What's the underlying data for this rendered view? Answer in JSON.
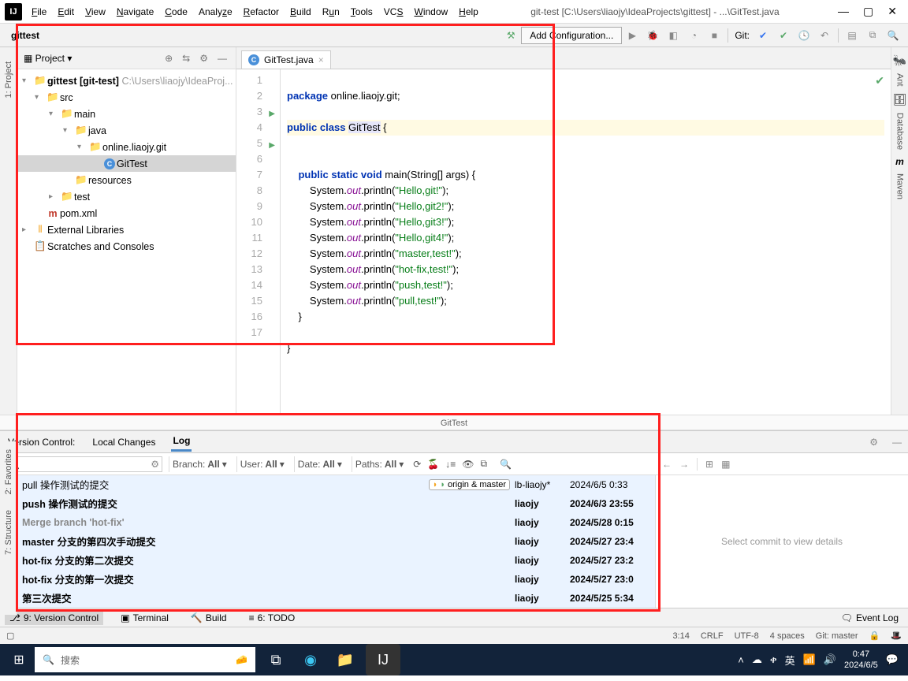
{
  "title": "git-test [C:\\Users\\liaojy\\IdeaProjects\\gittest] - ...\\GitTest.java",
  "menu": [
    "File",
    "Edit",
    "View",
    "Navigate",
    "Code",
    "Analyze",
    "Refactor",
    "Build",
    "Run",
    "Tools",
    "VCS",
    "Window",
    "Help"
  ],
  "breadcrumb": "gittest",
  "add_config": "Add Configuration...",
  "git_label": "Git:",
  "project_pane": {
    "title": "Project",
    "root": "gittest",
    "root_suffix": "[git-test]",
    "root_path": "C:\\Users\\liaojy\\IdeaProj...",
    "src": "src",
    "main": "main",
    "java": "java",
    "pkg": "online.liaojy.git",
    "class": "GitTest",
    "resources": "resources",
    "test": "test",
    "pom": "pom.xml",
    "ext": "External Libraries",
    "scratch": "Scratches and Consoles"
  },
  "tab": {
    "name": "GitTest.java"
  },
  "code": {
    "l1": "package online.liaojy.git;",
    "l3a": "public class ",
    "l3b": "GitTest",
    "l3c": " {",
    "l5a": "    public static void ",
    "l5b": "main",
    "l5c": "(String[] args) {",
    "sys": "        System.",
    "out": "out",
    "pln": ".println(",
    "s1": "\"Hello,git!\"",
    "s2": "\"Hello,git2!\"",
    "s3": "\"Hello,git3!\"",
    "s4": "\"Hello,git4!\"",
    "s5": "\"master,test!\"",
    "s6": "\"hot-fix,test!\"",
    "s7": "\"push,test!\"",
    "s8": "\"pull,test!\"",
    "end": ");",
    "cb": "    }",
    "cb2": "}"
  },
  "editor_crumb": "GitTest",
  "vc": {
    "title": "Version Control:",
    "tab_local": "Local Changes",
    "tab_log": "Log",
    "branch": "Branch:",
    "all": "All",
    "user": "User:",
    "date": "Date:",
    "paths": "Paths:",
    "detail_hint": "Select commit to view details"
  },
  "commits": [
    {
      "msg": "pull 操作测试的提交",
      "author": "lb-liaojy*",
      "date": "2024/6/5 0:33",
      "tag": "origin & master",
      "bold": false
    },
    {
      "msg": "push 操作测试的提交",
      "author": "liaojy",
      "date": "2024/6/3 23:55",
      "bold": true
    },
    {
      "msg": "Merge branch 'hot-fix'",
      "author": "liaojy",
      "date": "2024/5/28 0:15",
      "bold": true,
      "dim": true
    },
    {
      "msg": "master 分支的第四次手动提交",
      "author": "liaojy",
      "date": "2024/5/27 23:4",
      "bold": true
    },
    {
      "msg": "hot-fix 分支的第二次提交",
      "author": "liaojy",
      "date": "2024/5/27 23:2",
      "bold": true
    },
    {
      "msg": "hot-fix 分支的第一次提交",
      "author": "liaojy",
      "date": "2024/5/27 23:0",
      "bold": true
    },
    {
      "msg": "第三次提交",
      "author": "liaojy",
      "date": "2024/5/25 5:34",
      "bold": true
    }
  ],
  "bottom": {
    "vc": "9: Version Control",
    "term": "Terminal",
    "build": "Build",
    "todo": "6: TODO",
    "event": "Event Log"
  },
  "status": {
    "pos": "3:14",
    "crlf": "CRLF",
    "enc": "UTF-8",
    "indent": "4 spaces",
    "branch": "Git: master"
  },
  "taskbar": {
    "search": "搜索",
    "time": "0:47",
    "date": "2024/6/5"
  },
  "right": {
    "ant": "Ant",
    "db": "Database",
    "mvn": "Maven"
  },
  "left": {
    "proj": "1: Project",
    "fav": "2: Favorites",
    "struct": "7: Structure"
  }
}
